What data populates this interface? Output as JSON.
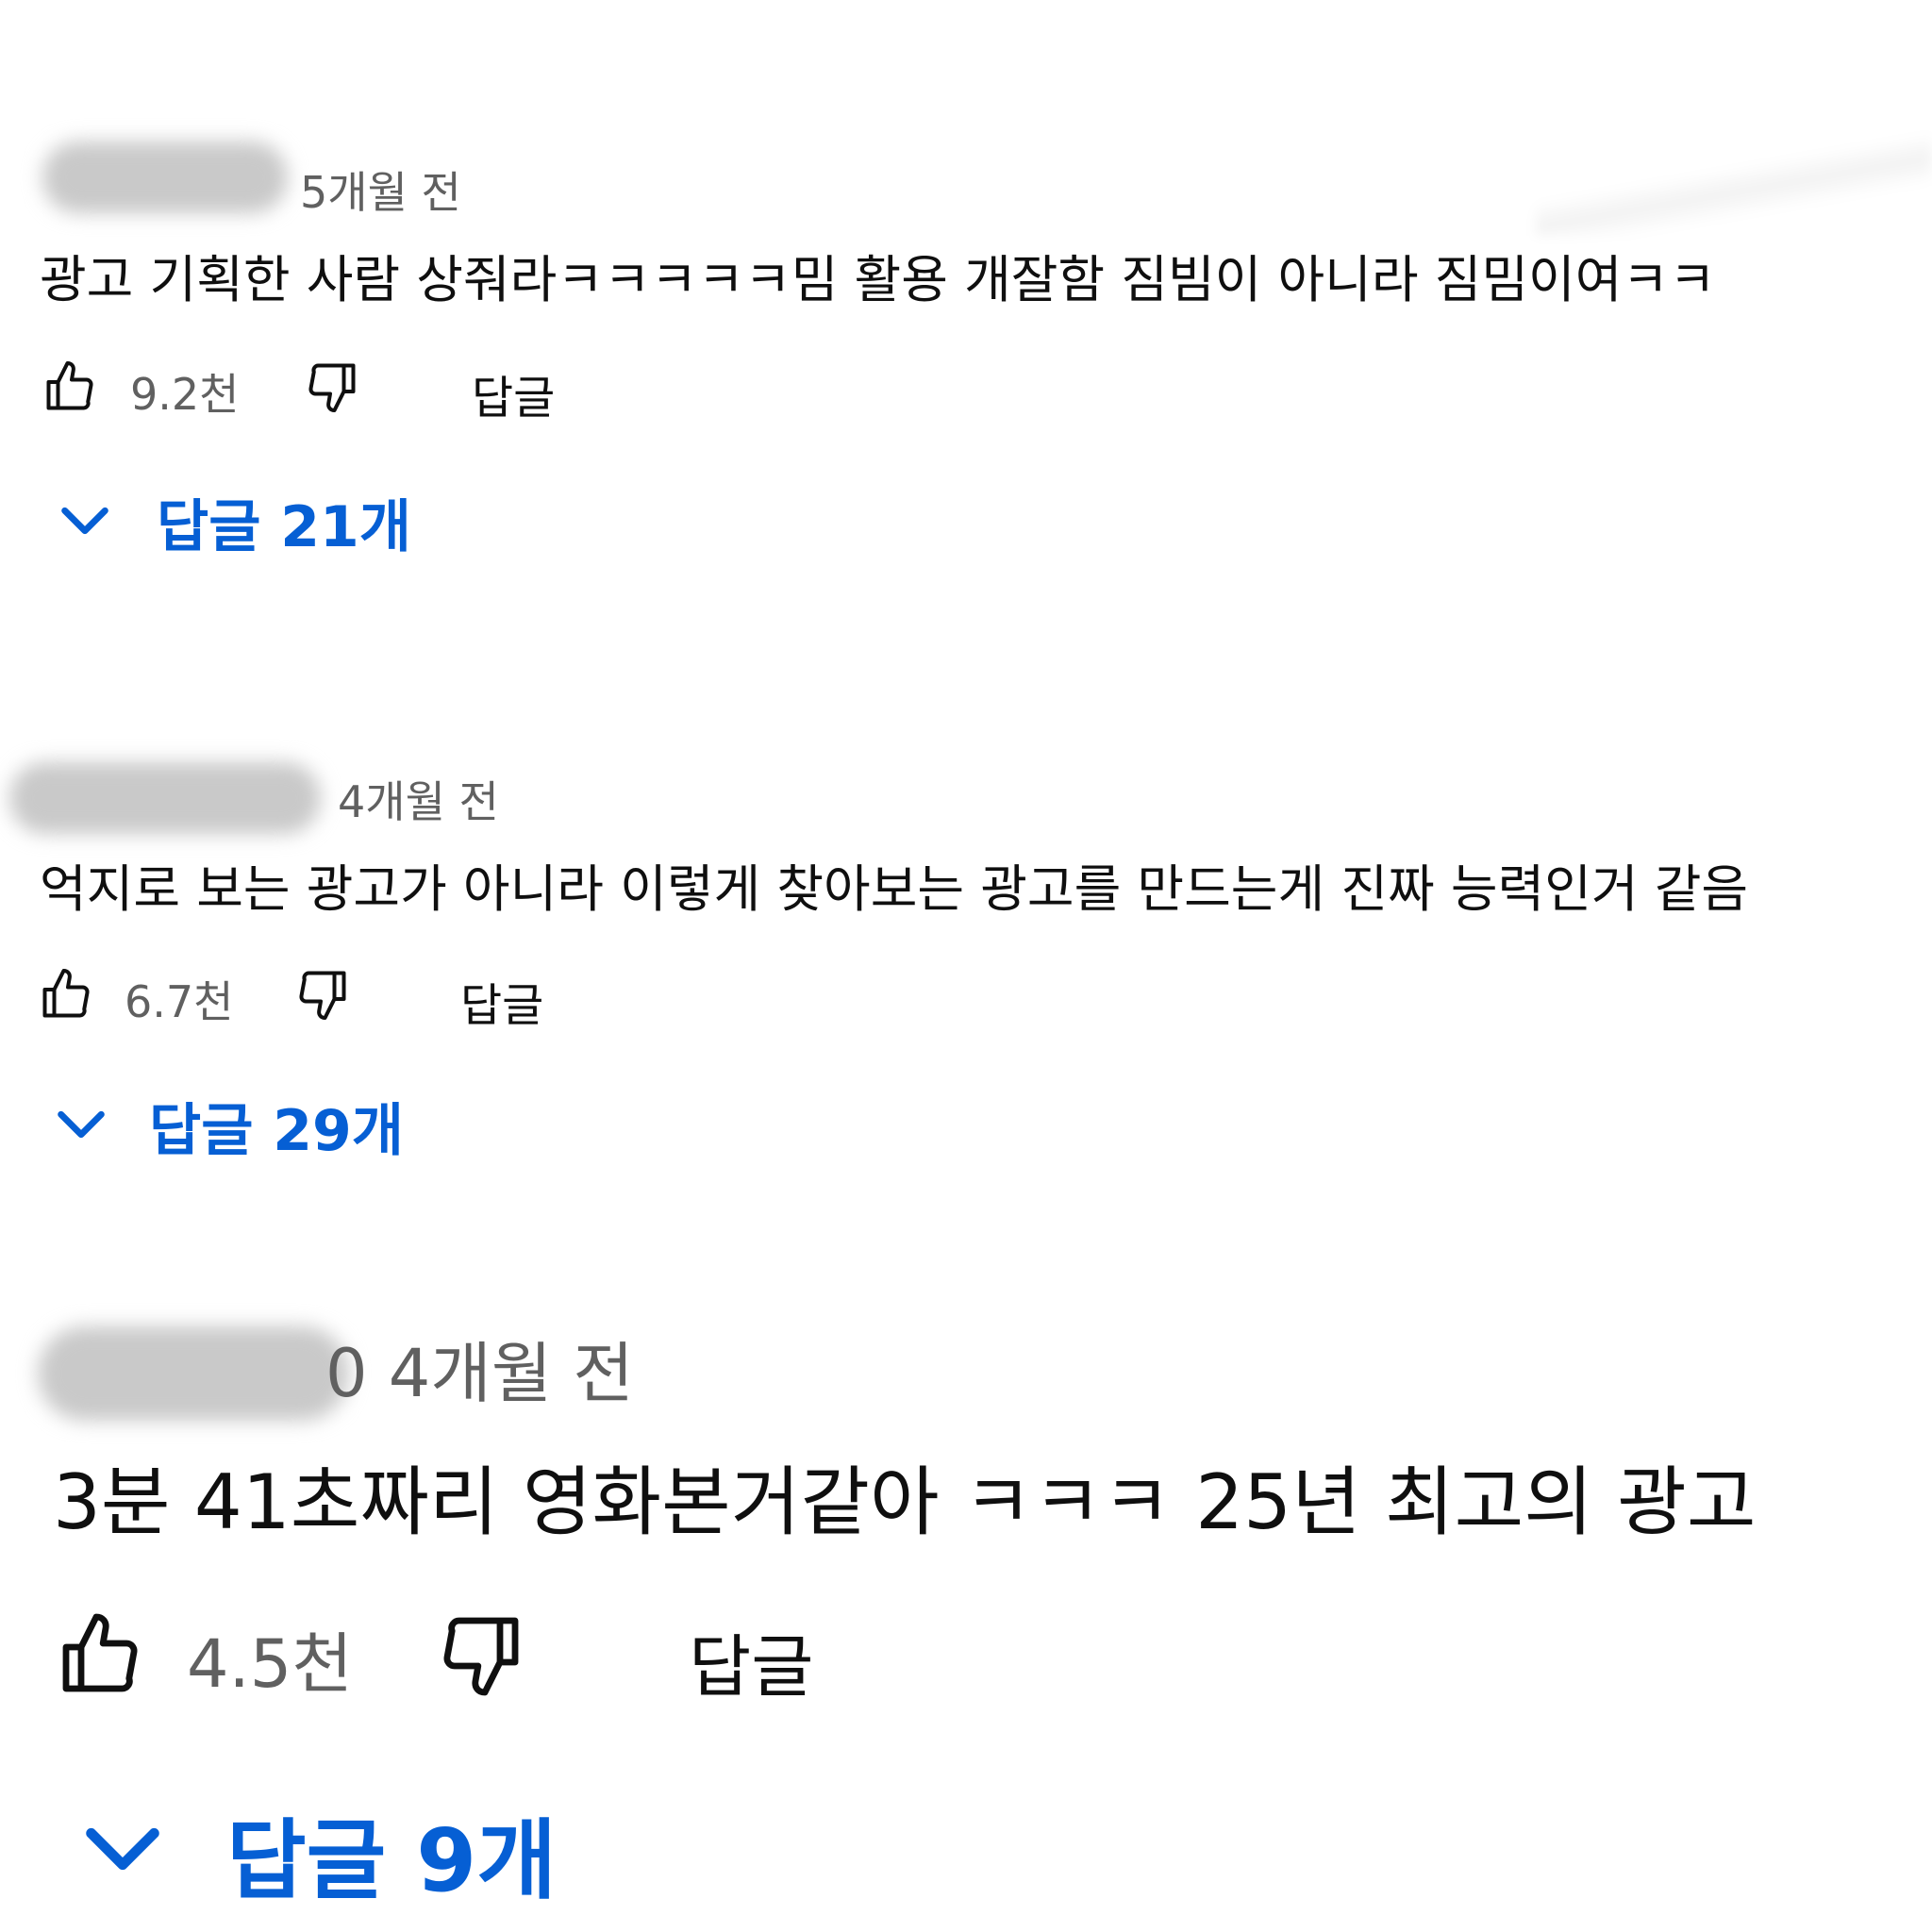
{
  "comments": [
    {
      "time": "5개월 전",
      "text": "광고 기획한 사람 상줘라ㅋㅋㅋㅋㅋ밈 활용 개잘함 짐빔이 아니라 짐밈이여ㅋㅋ",
      "likes": "9.2천",
      "reply_label": "답글",
      "replies_label": "답글 21개"
    },
    {
      "time": "4개월 전",
      "text": "억지로 보는 광고가 아니라 이렇게 찾아보는 광고를 만드는게 진짜 능력인거 같음",
      "likes": "6.7천",
      "reply_label": "답글",
      "replies_label": "답글 29개"
    },
    {
      "time": "0 4개월 전",
      "text": "3분 41초짜리 영화본거같아 ㅋㅋㅋ 25년 최고의 광고",
      "likes": "4.5천",
      "reply_label": "답글",
      "replies_label": "답글 9개"
    }
  ],
  "icons": {
    "like": "thumbs-up-icon",
    "dislike": "thumbs-down-icon",
    "expand": "chevron-down-icon"
  },
  "colors": {
    "link_blue": "#065fd4",
    "meta_gray": "#606060",
    "text": "#0f0f0f"
  }
}
